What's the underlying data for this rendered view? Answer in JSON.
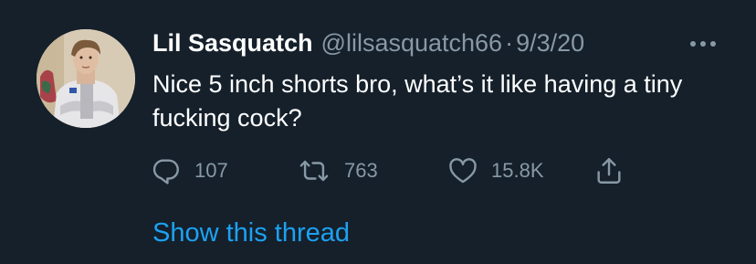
{
  "tweet": {
    "display_name": "Lil Sasquatch",
    "handle": "@lilsasquatch66",
    "separator": "·",
    "date": "9/3/20",
    "text": "Nice 5 inch shorts bro, what’s it like having a tiny fucking cock?",
    "more_icon": "more-horizontal-icon",
    "avatar_icon": "avatar-photo",
    "actions": {
      "reply": {
        "icon": "reply-icon",
        "count": "107"
      },
      "retweet": {
        "icon": "retweet-icon",
        "count": "763"
      },
      "like": {
        "icon": "heart-icon",
        "count": "15.8K"
      },
      "share": {
        "icon": "share-icon"
      }
    },
    "show_thread_label": "Show this thread"
  },
  "colors": {
    "background": "#15202b",
    "primary_text": "#ffffff",
    "secondary_text": "#8899a6",
    "link": "#1da1f2"
  }
}
